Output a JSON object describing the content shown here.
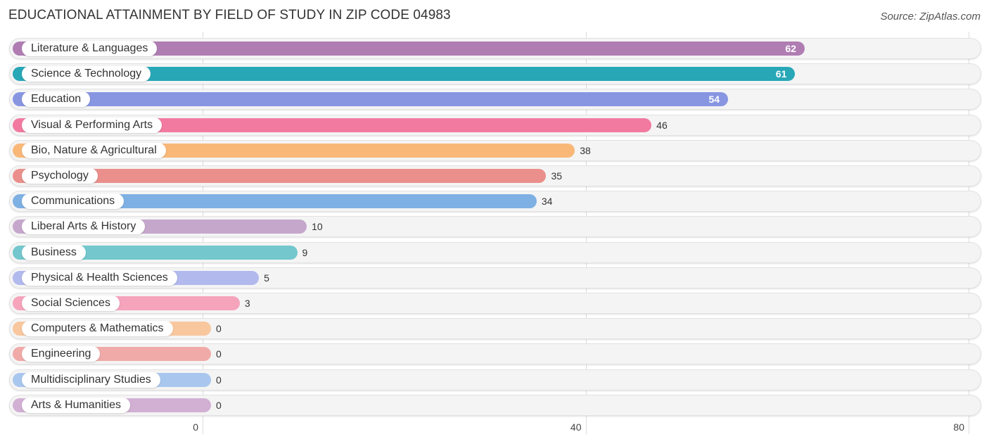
{
  "header": {
    "title": "EDUCATIONAL ATTAINMENT BY FIELD OF STUDY IN ZIP CODE 04983",
    "source": "Source: ZipAtlas.com"
  },
  "chart_data": {
    "type": "bar",
    "orientation": "horizontal",
    "title": "EDUCATIONAL ATTAINMENT BY FIELD OF STUDY IN ZIP CODE 04983",
    "xlabel": "",
    "ylabel": "",
    "xlim": [
      0,
      80
    ],
    "x_ticks": [
      "0",
      "40",
      "80"
    ],
    "grid": true,
    "categories": [
      "Literature & Languages",
      "Science & Technology",
      "Education",
      "Visual & Performing Arts",
      "Bio, Nature & Agricultural",
      "Psychology",
      "Communications",
      "Liberal Arts & History",
      "Business",
      "Physical & Health Sciences",
      "Social Sciences",
      "Computers & Mathematics",
      "Engineering",
      "Multidisciplinary Studies",
      "Arts & Humanities"
    ],
    "values": [
      62,
      61,
      54,
      46,
      38,
      35,
      34,
      10,
      9,
      5,
      3,
      0,
      0,
      0,
      0
    ],
    "colors": [
      "#b07db3",
      "#28a7b7",
      "#8896e2",
      "#f27aa0",
      "#f9b878",
      "#ea8f8b",
      "#7fb0e3",
      "#c5a7cb",
      "#73c7cd",
      "#b1b9ed",
      "#f6a3bc",
      "#f9c79e",
      "#f0aaa8",
      "#a9c7ee",
      "#d1b0d4"
    ]
  }
}
